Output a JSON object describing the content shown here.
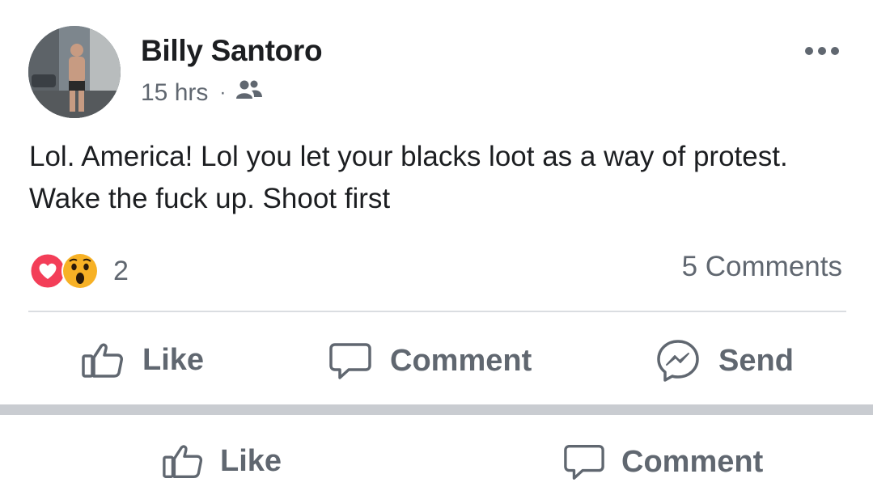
{
  "post": {
    "author": "Billy Santoro",
    "time": "15 hrs",
    "separator": "·",
    "privacy_icon": "friends-icon",
    "text": "Lol. America! Lol you let your blacks loot as a way of protest. Wake the fuck up. Shoot first",
    "reactions": {
      "icons": [
        "love-reaction-icon",
        "wow-reaction-icon"
      ],
      "count": "2"
    },
    "comments_count": "5 Comments"
  },
  "actions": {
    "like_label": "Like",
    "comment_label": "Comment",
    "send_label": "Send"
  },
  "bottom_actions": {
    "like_label": "Like",
    "comment_label": "Comment"
  },
  "colors": {
    "text_primary": "#1c1e21",
    "text_secondary": "#606770",
    "love_red": "#f33e58",
    "wow_yellow": "#f7b125",
    "divider": "#dadde1",
    "section_separator": "#c9ccd1"
  }
}
